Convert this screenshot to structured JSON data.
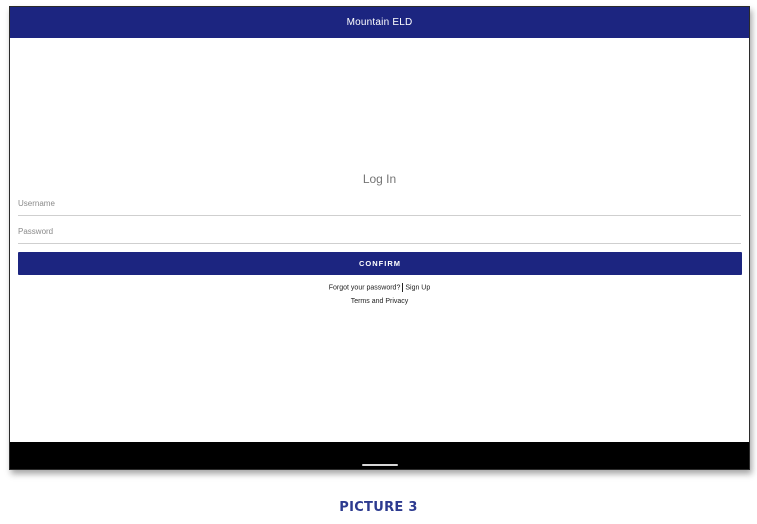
{
  "app": {
    "title": "Mountain ELD"
  },
  "login": {
    "heading": "Log In",
    "username_placeholder": "Username",
    "password_placeholder": "Password",
    "confirm_label": "CONFIRM",
    "forgot_label": "Forgot your password?",
    "signup_label": "Sign Up",
    "terms_label": "Terms and Privacy"
  },
  "caption": "PICTURE 3",
  "colors": {
    "brand": "#1c2580",
    "caption": "#2c3a8f"
  }
}
